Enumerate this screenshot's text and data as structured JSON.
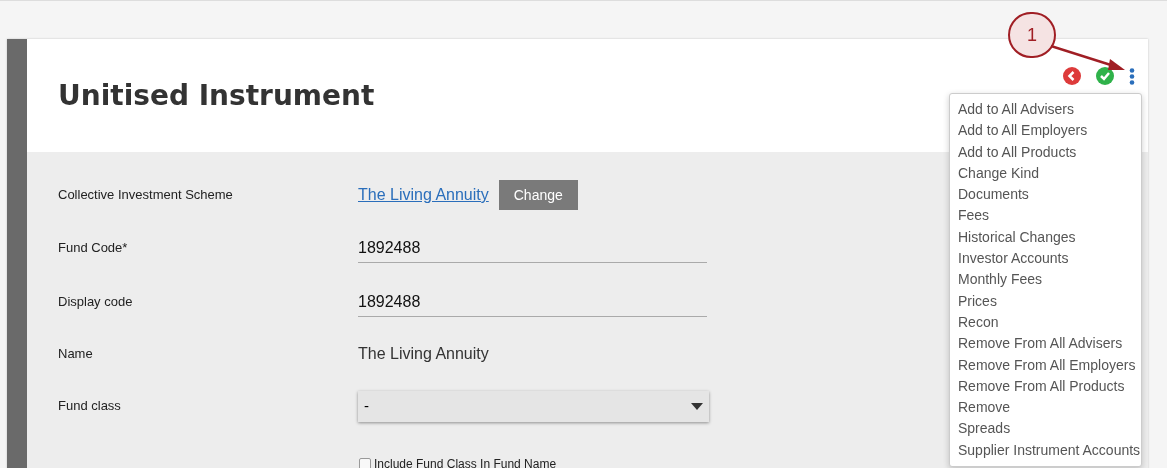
{
  "header": {
    "title": "Unitised Instrument"
  },
  "annotation": {
    "label": "1"
  },
  "form": [
    {
      "kind": "link",
      "label": "Collective Investment Scheme",
      "value": "The Living Annuity",
      "button": "Change"
    },
    {
      "kind": "input",
      "label": "Fund Code*",
      "value": "1892488"
    },
    {
      "kind": "input",
      "label": "Display code",
      "value": "1892488"
    },
    {
      "kind": "text",
      "label": "Name",
      "value": "The Living Annuity"
    },
    {
      "kind": "select",
      "label": "Fund class",
      "value": "-"
    },
    {
      "kind": "checkbox",
      "label": "Include Fund Class In Fund Name",
      "checked": false
    }
  ],
  "menu": {
    "items": [
      "Add to All Advisers",
      "Add to All Employers",
      "Add to All Products",
      "Change Kind",
      "Documents",
      "Fees",
      "Historical Changes",
      "Investor Accounts",
      "Monthly Fees",
      "Prices",
      "Recon",
      "Remove From All Advisers",
      "Remove From All Employers",
      "Remove From All Products",
      "Remove",
      "Spreads",
      "Supplier Instrument Accounts"
    ]
  }
}
